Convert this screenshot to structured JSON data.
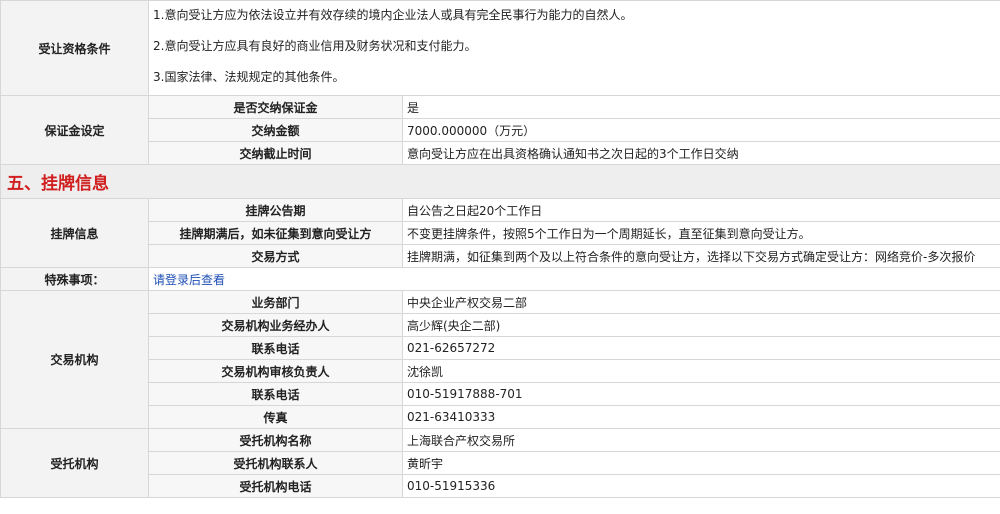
{
  "eligibility": {
    "label": "受让资格条件",
    "lines": [
      "1.意向受让方应为依法设立并有效存续的境内企业法人或具有完全民事行为能力的自然人。",
      "2.意向受让方应具有良好的商业信用及财务状况和支付能力。",
      "3.国家法律、法规规定的其他条件。"
    ]
  },
  "deposit": {
    "label": "保证金设定",
    "rows": [
      {
        "k": "是否交纳保证金",
        "v": "是"
      },
      {
        "k": "交纳金额",
        "v": "7000.000000（万元）"
      },
      {
        "k": "交纳截止时间",
        "v": "意向受让方应在出具资格确认通知书之次日起的3个工作日交纳"
      }
    ]
  },
  "section5": {
    "title": "五、挂牌信息"
  },
  "listing": {
    "label": "挂牌信息",
    "rows": [
      {
        "k": "挂牌公告期",
        "v": "自公告之日起20个工作日"
      },
      {
        "k": "挂牌期满后，如未征集到意向受让方",
        "v": "不变更挂牌条件，按照5个工作日为一个周期延长，直至征集到意向受让方。"
      },
      {
        "k": "交易方式",
        "v": "挂牌期满，如征集到两个及以上符合条件的意向受让方，选择以下交易方式确定受让方：网络竞价-多次报价"
      }
    ]
  },
  "special": {
    "label": "特殊事项：",
    "link": "请登录后查看"
  },
  "exchange": {
    "label": "交易机构",
    "rows": [
      {
        "k": "业务部门",
        "v": "中央企业产权交易二部"
      },
      {
        "k": "交易机构业务经办人",
        "v": "高少辉(央企二部)"
      },
      {
        "k": "联系电话",
        "v": "021-62657272"
      },
      {
        "k": "交易机构审核负责人",
        "v": "沈徐凯"
      },
      {
        "k": "联系电话",
        "v": "010-51917888-701"
      },
      {
        "k": "传真",
        "v": "021-63410333"
      }
    ]
  },
  "entrusted": {
    "label": "受托机构",
    "rows": [
      {
        "k": "受托机构名称",
        "v": "上海联合产权交易所"
      },
      {
        "k": "受托机构联系人",
        "v": "黄昕宇"
      },
      {
        "k": "受托机构电话",
        "v": "010-51915336"
      }
    ]
  }
}
